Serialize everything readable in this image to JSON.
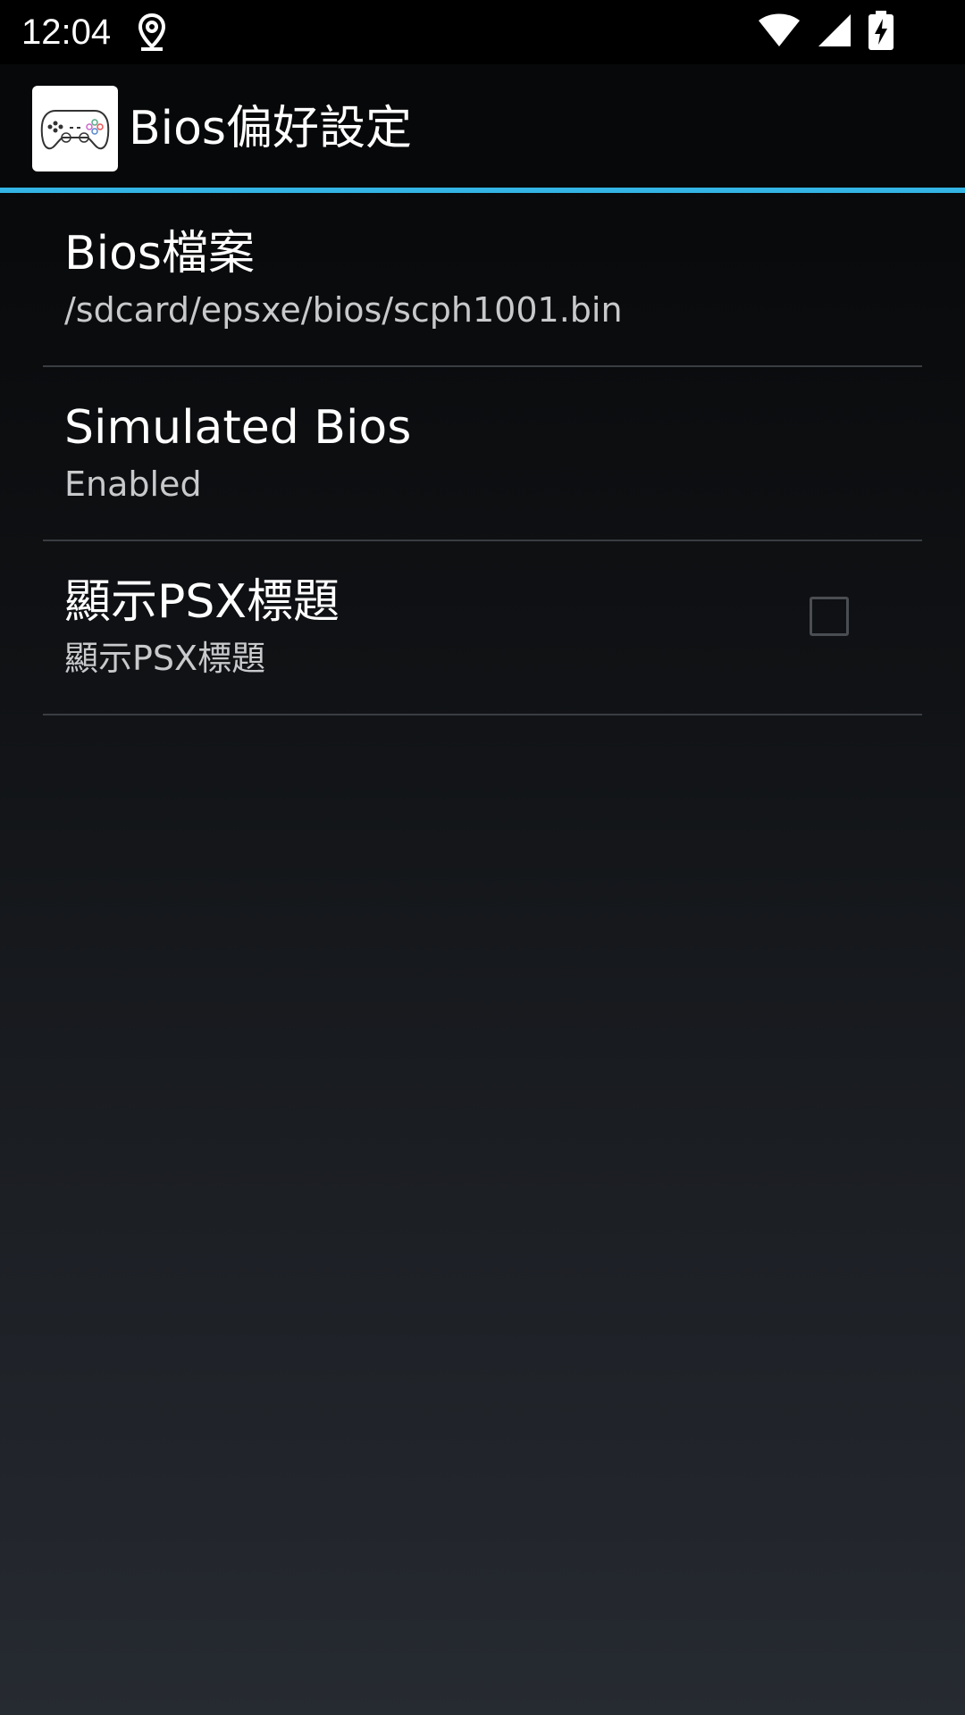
{
  "status_bar": {
    "time": "12:04",
    "icons": [
      "location-icon",
      "wifi-icon",
      "signal-icon",
      "battery-charging-icon"
    ]
  },
  "action_bar": {
    "title": "Bios偏好設定",
    "app_icon": "gamepad-icon",
    "accent_color": "#33b5e5"
  },
  "preferences": [
    {
      "title": "Bios檔案",
      "summary": "/sdcard/epsxe/bios/scph1001.bin"
    },
    {
      "title": "Simulated Bios",
      "summary": "Enabled"
    },
    {
      "title": "顯示PSX標題",
      "summary": "顯示PSX標題",
      "checked": false
    }
  ]
}
